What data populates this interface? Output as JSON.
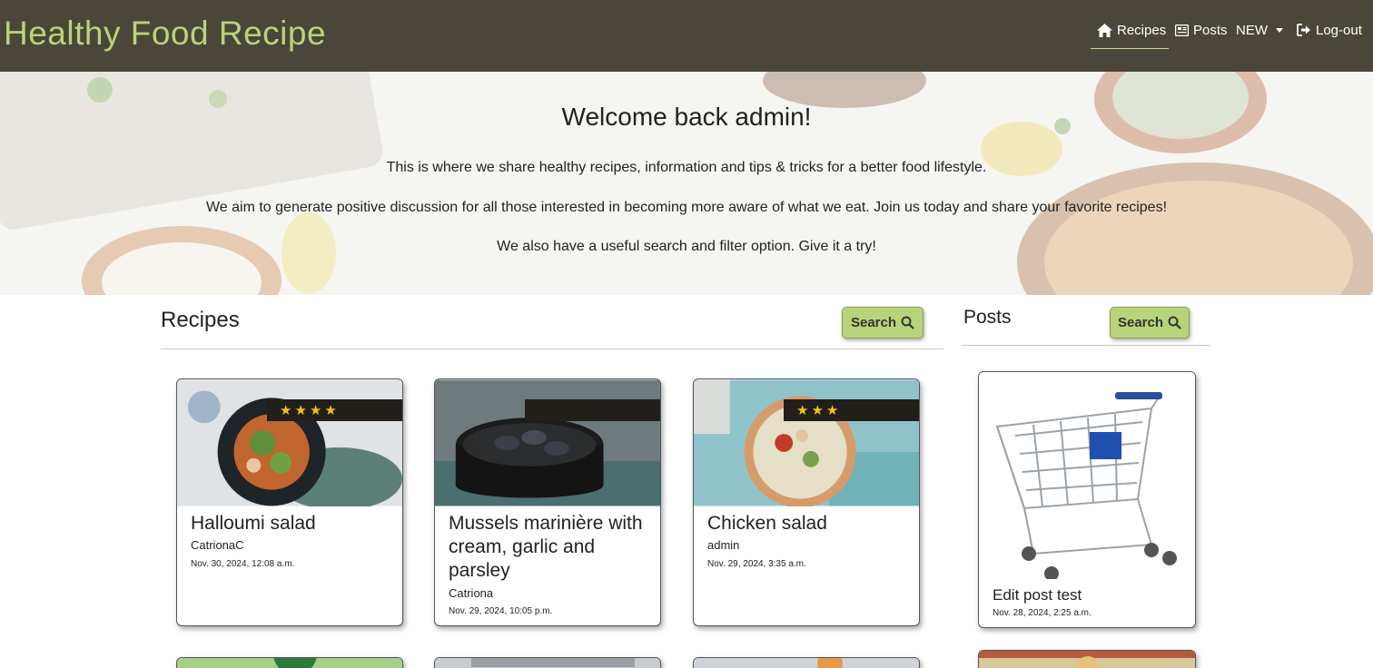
{
  "navbar": {
    "brand": "Healthy Food Recipe",
    "links": {
      "recipes": "Recipes",
      "posts": "Posts",
      "new": "NEW",
      "logout": "Log-out"
    }
  },
  "hero": {
    "title": "Welcome back admin!",
    "line1": "This is where we share healthy recipes, information and tips & tricks for a better food lifestyle.",
    "line2": "We aim to generate positive discussion for all those interested in becoming more aware of what we eat. Join us today and share your favorite recipes!",
    "line3": "We also have a useful search and filter option. Give it a try!"
  },
  "recipes_section": {
    "title": "Recipes",
    "search_label": "Search",
    "cards": [
      {
        "title": "Halloumi salad",
        "author": "CatrionaC",
        "date": "Nov. 30, 2024, 12:08 a.m.",
        "rating": 4
      },
      {
        "title": "Mussels marinière with cream, garlic and parsley",
        "author": "Catriona",
        "date": "Nov. 29, 2024, 10:05 p.m.",
        "rating": 0
      },
      {
        "title": "Chicken salad",
        "author": "admin",
        "date": "Nov. 29, 2024, 3:35 a.m.",
        "rating": 3
      }
    ]
  },
  "posts_section": {
    "title": "Posts",
    "search_label": "Search",
    "cards": [
      {
        "title": "Edit post test",
        "date": "Nov. 28, 2024, 2:25 a.m."
      }
    ]
  },
  "colors": {
    "navbar_bg": "#4a4639",
    "brand": "#b9d37a",
    "search_button": "#b9d37a",
    "rating_band": "#221f1a",
    "star": "#f1c40f"
  }
}
